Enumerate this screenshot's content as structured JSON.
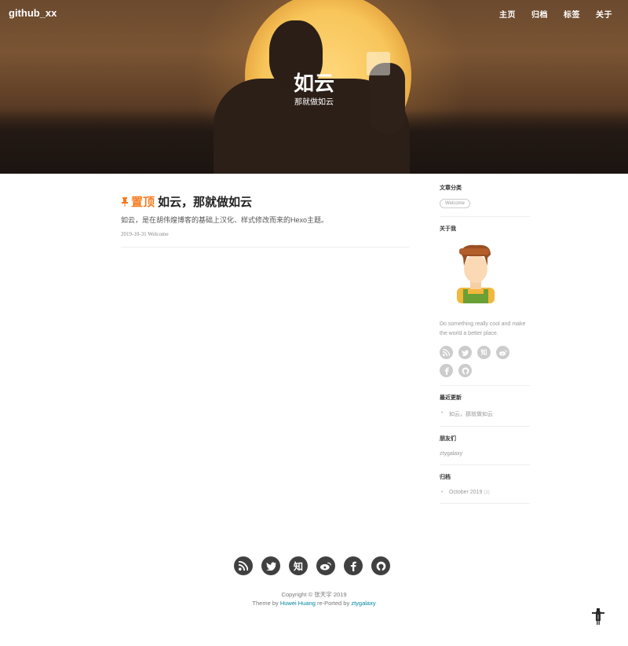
{
  "header": {
    "site_title": "github_xx",
    "nav": [
      "主页",
      "归档",
      "标签",
      "关于"
    ],
    "hero_title": "如云",
    "hero_subtitle": "那就做如云"
  },
  "post": {
    "pin_label": "置顶",
    "title": "如云，那就做如云",
    "subtitle": "如云，是在胡伟煌博客的基础上汉化、样式修改而来的Hexo主题。",
    "date": "2019-10-31",
    "tag": "Welcome"
  },
  "sidebar": {
    "categories_title": "文章分类",
    "category_tag": "Welcome",
    "about_title": "关于我",
    "about_text": "Do something really cool and make the world a better place.",
    "social_icons": [
      "rss-icon",
      "twitter-icon",
      "zhihu-icon",
      "weibo-icon",
      "facebook-icon",
      "github-icon"
    ],
    "zhihu_glyph": "知",
    "recent_title": "最近更新",
    "recent_posts": [
      "如云，那就做如云"
    ],
    "friends_title": "朋友们",
    "friends": [
      "ztygalaxy"
    ],
    "archive_title": "归档",
    "archives": [
      {
        "label": "October 2019",
        "count": "(1)"
      }
    ]
  },
  "footer": {
    "social_icons": [
      "rss-icon",
      "twitter-icon",
      "zhihu-icon",
      "weibo-icon",
      "facebook-icon",
      "github-icon"
    ],
    "zhihu_glyph": "知",
    "copyright": "Copyright © 张天宇 2019",
    "theme_prefix": "Theme by ",
    "theme_author": "Huwei Huang",
    "theme_middle": " re-Ported by ",
    "theme_porter": "ztygalaxy"
  },
  "colors": {
    "accent": "#f57b20",
    "link": "#0085a1",
    "footer_icon_bg": "#404040",
    "side_icon_bg": "#cccccc"
  }
}
